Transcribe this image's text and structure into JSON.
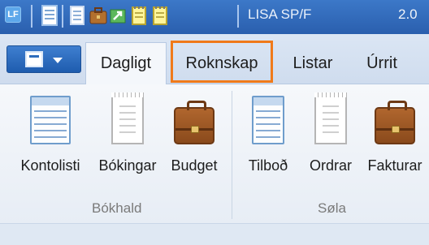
{
  "title_bar": {
    "logo": "LF",
    "title": "LISA SP/F",
    "right_text": "2.0",
    "quick_access_icons": [
      "document-list-icon",
      "receipt-icon",
      "briefcase-icon",
      "green-arrow-icon",
      "notepad-icon",
      "notepad-icon"
    ]
  },
  "file_button": {
    "icon": "file-menu-icon"
  },
  "tabs": [
    {
      "label": "Dagligt",
      "active": true
    },
    {
      "label": "Roknskap",
      "active": false,
      "highlighted": true
    },
    {
      "label": "Listar",
      "active": false
    },
    {
      "label": "Úrrit",
      "active": false
    }
  ],
  "ribbon": {
    "groups": [
      {
        "label": "Bókhald",
        "buttons": [
          {
            "label": "Kontolisti",
            "icon": "list-icon"
          },
          {
            "label": "Bókingar",
            "icon": "receipt-icon"
          },
          {
            "label": "Budget",
            "icon": "briefcase-icon"
          }
        ]
      },
      {
        "label": "Søla",
        "buttons": [
          {
            "label": "Tilboð",
            "icon": "list-icon"
          },
          {
            "label": "Ordrar",
            "icon": "receipt-icon"
          },
          {
            "label": "Fakturar",
            "icon": "briefcase-icon"
          }
        ]
      }
    ]
  },
  "colors": {
    "title_bar": "#2f67b6",
    "highlight": "#f07a1a",
    "ribbon_bg": "#f3f6fa"
  }
}
